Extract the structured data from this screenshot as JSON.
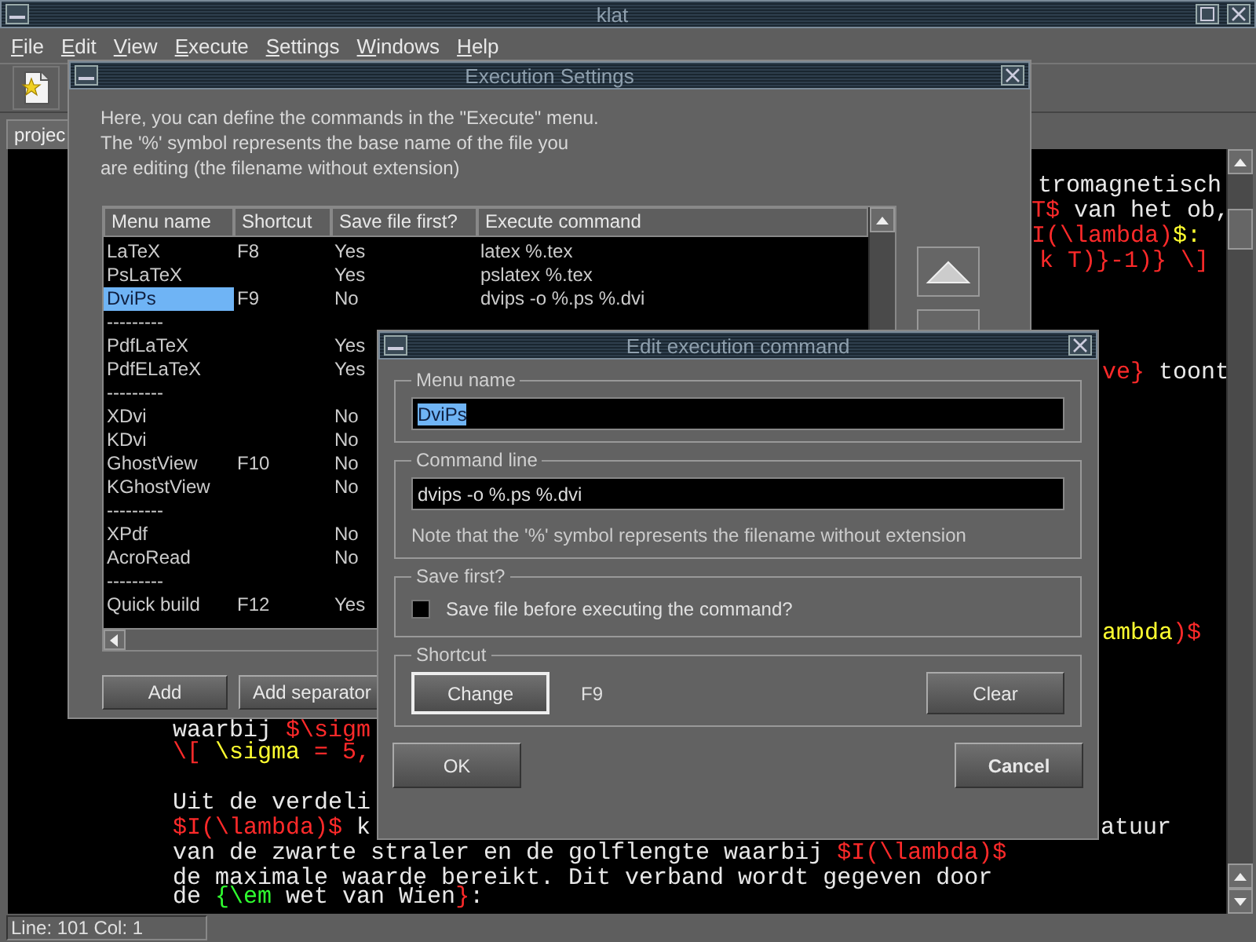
{
  "window": {
    "title": "klat"
  },
  "menu": [
    "File",
    "Edit",
    "View",
    "Execute",
    "Settings",
    "Windows",
    "Help"
  ],
  "tabs": [
    {
      "label": "projec",
      "selected": true
    }
  ],
  "editor": {
    "fragments": [
      {
        "segments": [
          {
            "text": "tromagnetisch",
            "color": "#e8e8e8"
          }
        ]
      },
      {
        "segments": [
          {
            "text": "T$",
            "color": "#ff2a2a"
          },
          {
            "text": " van het ob,",
            "color": "#e8e8e8"
          }
        ]
      },
      {
        "segments": [
          {
            "text": "I(\\lambda)",
            "color": "#ff2a2a"
          },
          {
            "text": "$:",
            "color": "#ffff30"
          }
        ]
      },
      {
        "segments": [
          {
            "text": "k T)}-1)} \\]",
            "color": "#ff2a2a"
          }
        ]
      },
      {
        "segments": [
          {
            "text": "ve}",
            "color": "#ff2a2a"
          },
          {
            "text": " toont",
            "color": "#e8e8e8"
          }
        ]
      },
      {
        "segments": [
          {
            "text": "ambda",
            "color": "#ffff30"
          },
          {
            "text": ")$",
            "color": "#ff2a2a"
          }
        ]
      },
      {
        "segments": [
          {
            "text": "waarbij ",
            "color": "#e8e8e8"
          },
          {
            "text": "$\\sigm",
            "color": "#ff2a2a"
          }
        ]
      },
      {
        "segments": [
          {
            "text": "\\[ ",
            "color": "#ff2a2a"
          },
          {
            "text": "\\sigma",
            "color": "#ffff30"
          },
          {
            "text": " = 5,",
            "color": "#ff2a2a"
          }
        ]
      },
      {
        "segments": [
          {
            "text": "Uit de verdeli",
            "color": "#e8e8e8"
          }
        ]
      },
      {
        "segments": [
          {
            "text": "$I(\\lambda)$",
            "color": "#ff2a2a"
          },
          {
            "text": " k",
            "color": "#e8e8e8"
          }
        ]
      },
      {
        "segments": [
          {
            "text": "atuur",
            "color": "#e8e8e8"
          }
        ]
      },
      {
        "segments": [
          {
            "text": "van de zwarte straler en de golflengte waarbij ",
            "color": "#e8e8e8"
          },
          {
            "text": "$I(\\lambda)$",
            "color": "#ff2a2a"
          }
        ]
      },
      {
        "segments": [
          {
            "text": "de maximale waarde bereikt. Dit verband wordt gegeven door",
            "color": "#e8e8e8"
          }
        ]
      },
      {
        "segments": [
          {
            "text": "de ",
            "color": "#e8e8e8"
          },
          {
            "text": "{\\em",
            "color": "#30ff30"
          },
          {
            "text": " wet van Wien",
            "color": "#e8e8e8"
          },
          {
            "text": "}",
            "color": "#ff2a2a"
          },
          {
            "text": ":",
            "color": "#e8e8e8"
          }
        ]
      }
    ]
  },
  "status_bar": "Line: 101 Col: 1",
  "execution_settings": {
    "title": "Execution Settings",
    "description": [
      "Here, you can define the commands in the \"Execute\" menu.",
      "The '%' symbol represents the base name of the file you",
      "are editing (the filename without extension)"
    ],
    "columns": [
      "Menu name",
      "Shortcut",
      "Save file first?",
      "Execute command"
    ],
    "rows": [
      {
        "menu_name": "LaTeX",
        "shortcut": "F8",
        "save_first": "Yes",
        "command": "latex %.tex",
        "selected": false
      },
      {
        "menu_name": "PsLaTeX",
        "save_first": "Yes",
        "command": "pslatex %.tex",
        "selected": false
      },
      {
        "menu_name": "DviPs",
        "shortcut": "F9",
        "save_first": "No",
        "command": "dvips -o %.ps %.dvi",
        "selected": true
      },
      {
        "menu_name": "---------",
        "selected": false
      },
      {
        "menu_name": "PdfLaTeX",
        "save_first": "Yes",
        "selected": false
      },
      {
        "menu_name": "PdfELaTeX",
        "save_first": "Yes",
        "selected": false
      },
      {
        "menu_name": "---------",
        "selected": false
      },
      {
        "menu_name": "XDvi",
        "save_first": "No",
        "selected": false
      },
      {
        "menu_name": "KDvi",
        "save_first": "No",
        "selected": false
      },
      {
        "menu_name": "GhostView",
        "shortcut": "F10",
        "save_first": "No",
        "selected": false
      },
      {
        "menu_name": "KGhostView",
        "save_first": "No",
        "selected": false
      },
      {
        "menu_name": "---------",
        "selected": false
      },
      {
        "menu_name": "XPdf",
        "save_first": "No",
        "selected": false
      },
      {
        "menu_name": "AcroRead",
        "save_first": "No",
        "selected": false
      },
      {
        "menu_name": "---------",
        "selected": false
      },
      {
        "menu_name": "Quick build",
        "shortcut": "F12",
        "save_first": "Yes",
        "selected": false
      }
    ],
    "buttons": [
      "Add",
      "Add separator"
    ]
  },
  "edit_command": {
    "title": "Edit execution command",
    "menu_name": {
      "label": "Menu name",
      "value": "DviPs",
      "value_selected": true
    },
    "command_line": {
      "label": "Command line",
      "value": "dvips -o %.ps %.dvi",
      "note": "Note that the '%' symbol represents the filename without extension"
    },
    "save_first": {
      "label": "Save first?",
      "option": "Save file before executing the command?",
      "checked": false
    },
    "shortcut": {
      "label": "Shortcut",
      "key": "F9",
      "buttons": [
        {
          "label": "Change",
          "focused": true
        },
        {
          "label": "Clear",
          "focused": false
        }
      ]
    },
    "buttons": [
      {
        "label": "OK",
        "default": false
      },
      {
        "label": "Cancel",
        "default": true
      }
    ]
  }
}
